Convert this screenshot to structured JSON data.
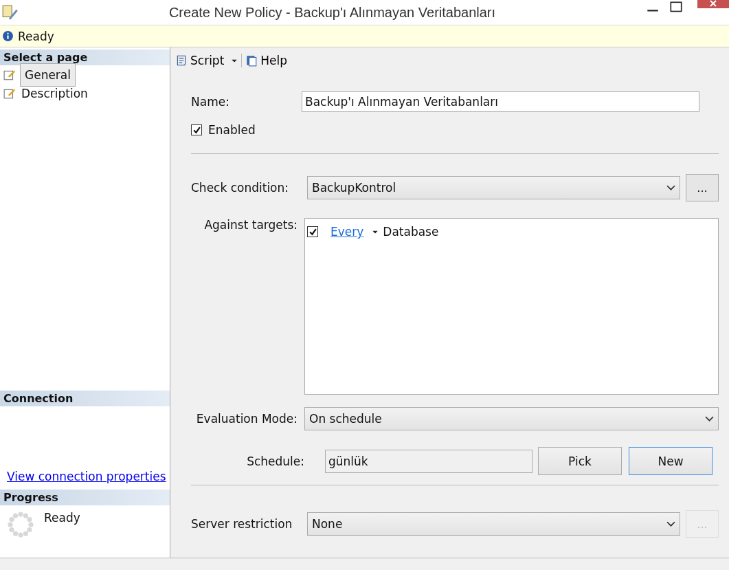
{
  "window": {
    "title": "Create New Policy - Backup'ı Alınmayan Veritabanları"
  },
  "status": {
    "text": "Ready"
  },
  "sidebar": {
    "header": "Select a page",
    "pages": [
      {
        "label": "General",
        "selected": true
      },
      {
        "label": "Description",
        "selected": false
      }
    ],
    "connection": {
      "header": "Connection",
      "link": "View connection properties"
    },
    "progress": {
      "header": "Progress",
      "status": "Ready"
    }
  },
  "toolbar": [
    {
      "label": "Script",
      "kind": "script"
    },
    {
      "label": "Help",
      "kind": "help"
    }
  ],
  "form": {
    "name": {
      "label": "Name:",
      "value": "Backup'ı Alınmayan Veritabanları"
    },
    "enabled": {
      "label": "Enabled",
      "checked": true
    },
    "check_condition": {
      "label": "Check condition:",
      "value": "BackupKontrol",
      "more": "...",
      "more_disabled": false
    },
    "targets": {
      "label": "Against targets:",
      "items": [
        {
          "checked": true,
          "link": "Every",
          "text": "Database"
        }
      ]
    },
    "evaluation_mode": {
      "label": "Evaluation Mode:",
      "value": "On schedule"
    },
    "schedule": {
      "label": "Schedule:",
      "value": "günlük",
      "buttons": [
        {
          "label": "Pick",
          "focused": false
        },
        {
          "label": "New",
          "focused": true
        }
      ]
    },
    "server_restriction": {
      "label": "Server restriction",
      "value": "None",
      "more": "...",
      "more_disabled": true
    }
  }
}
